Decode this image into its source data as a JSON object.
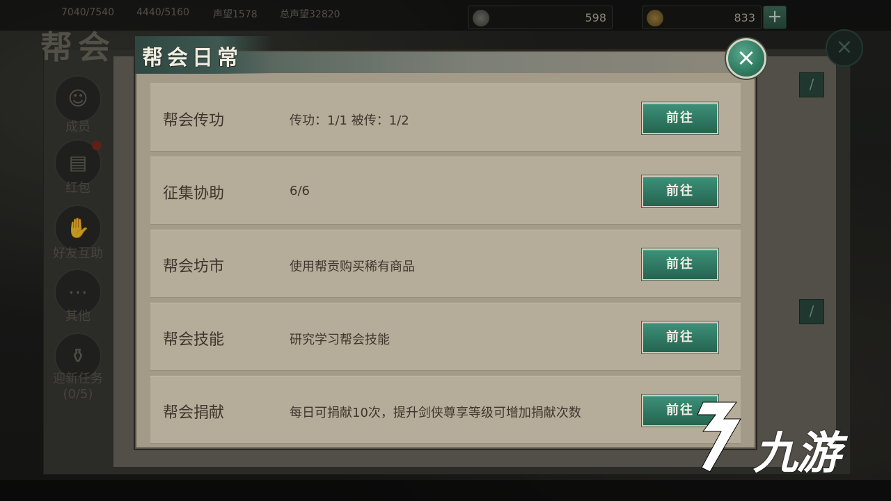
{
  "top_bar": {
    "faint_stats": [
      "7040/7540",
      "4440/5160",
      "声望1578",
      "总声望32820"
    ],
    "resources": [
      {
        "icon": "silver-coin-icon",
        "value": "598"
      },
      {
        "icon": "gold-ingot-icon",
        "value": "833"
      }
    ],
    "add_label": "+"
  },
  "guild_panel": {
    "title": "帮会",
    "nav": [
      {
        "label": "成员",
        "icon": "member-icon"
      },
      {
        "label": "红包",
        "icon": "red-packet-icon"
      },
      {
        "label": "好友互助",
        "icon": "handshake-icon"
      },
      {
        "label": "其他",
        "icon": "scroll-icon"
      },
      {
        "label": "迎新任务",
        "sub": "(0/5)",
        "icon": "wine-jar-icon"
      }
    ],
    "close_label": "×"
  },
  "modal": {
    "title": "帮会日常",
    "close_label": "×",
    "tasks": [
      {
        "name": "帮会传功",
        "desc": "传功：1/1 被传：1/2",
        "button": "前往"
      },
      {
        "name": "征集协助",
        "desc": "6/6",
        "button": "前往"
      },
      {
        "name": "帮会坊市",
        "desc": "使用帮贡购买稀有商品",
        "button": "前往"
      },
      {
        "name": "帮会技能",
        "desc": "研究学习帮会技能",
        "button": "前往"
      },
      {
        "name": "帮会捐献",
        "desc": "每日可捐献10次，提升剑侠尊享等级可增加捐献次数",
        "button": "前往"
      }
    ]
  },
  "watermark": {
    "text": "九游",
    "icon": "jiuyou-logo-icon"
  },
  "colors": {
    "accent_green": "#2f7863",
    "panel_bg": "#a49a88",
    "row_bg": "#b6ac9a",
    "text_dark": "#3e362d"
  }
}
